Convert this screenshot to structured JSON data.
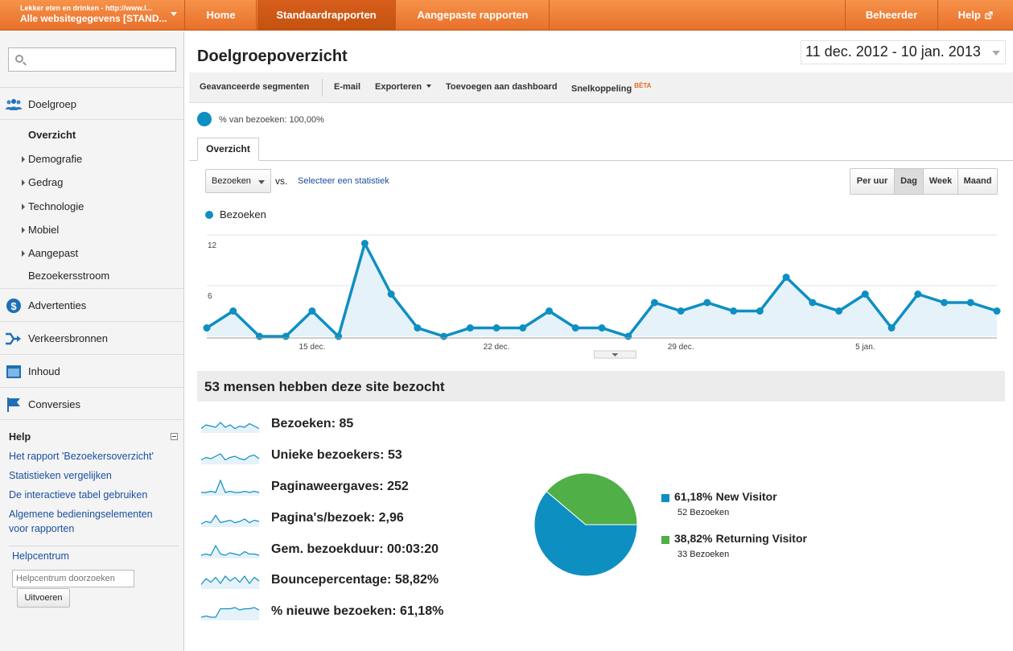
{
  "account": {
    "site": "Lekker eten en drinken - http://www.l...",
    "view": "Alle websitegegevens [STAND..."
  },
  "nav": {
    "home": "Home",
    "standard_reports": "Standaardrapporten",
    "custom_reports": "Aangepaste rapporten",
    "admin": "Beheerder",
    "help": "Help"
  },
  "sidebar": {
    "search_placeholder": "",
    "audience": "Doelgroep",
    "sub_items": [
      "Overzicht",
      "Demografie",
      "Gedrag",
      "Technologie",
      "Mobiel",
      "Aangepast",
      "Bezoekersstroom"
    ],
    "advertising": "Advertenties",
    "traffic_sources": "Verkeersbronnen",
    "content": "Inhoud",
    "conversions": "Conversies",
    "help_title": "Help",
    "help_links": [
      "Het rapport 'Bezoekersoverzicht'",
      "Statistieken vergelijken",
      "De interactieve tabel gebruiken",
      "Algemene bedieningselementen voor rapporten"
    ],
    "helpcenter": "Helpcentrum",
    "helpcenter_placeholder": "Helpcentrum doorzoeken",
    "execute": "Uitvoeren"
  },
  "page": {
    "title": "Doelgroepoverzicht",
    "date_range": "11 dec. 2012 - 10 jan. 2013"
  },
  "toolbar": {
    "advanced_segments": "Geavanceerde segmenten",
    "email": "E-mail",
    "export": "Exporteren",
    "add_to_dashboard": "Toevoegen aan dashboard",
    "shortcut": "Snelkoppeling",
    "beta": "BÈTA"
  },
  "segment": {
    "text": "% van bezoeken: 100,00%"
  },
  "tab": {
    "overview": "Overzicht"
  },
  "controls": {
    "metric": "Bezoeken",
    "vs": "vs.",
    "select_stat": "Selecteer een statistiek",
    "granularity": [
      "Per uur",
      "Dag",
      "Week",
      "Maand"
    ],
    "selected_granularity": "Dag"
  },
  "colors": {
    "accent_orange": "#e8702a",
    "series_blue": "#0e8fc2",
    "returning_green": "#50af47"
  },
  "chart_data": [
    {
      "type": "line",
      "series": [
        {
          "name": "Bezoeken",
          "values": [
            1,
            3,
            0,
            0,
            3,
            0,
            11,
            5,
            1,
            0,
            1,
            1,
            1,
            3,
            1,
            1,
            0,
            4,
            3,
            4,
            3,
            3,
            7,
            4,
            3,
            5,
            1,
            5,
            4,
            4,
            3
          ]
        }
      ],
      "x": [
        "11 dec.",
        "12 dec.",
        "13 dec.",
        "14 dec.",
        "15 dec.",
        "16 dec.",
        "17 dec.",
        "18 dec.",
        "19 dec.",
        "20 dec.",
        "21 dec.",
        "22 dec.",
        "23 dec.",
        "24 dec.",
        "25 dec.",
        "26 dec.",
        "27 dec.",
        "28 dec.",
        "29 dec.",
        "30 dec.",
        "31 dec.",
        "1 jan.",
        "2 jan.",
        "3 jan.",
        "4 jan.",
        "5 jan.",
        "6 jan.",
        "7 jan.",
        "8 jan.",
        "9 jan.",
        "10 jan."
      ],
      "x_tick_labels": [
        "15 dec.",
        "22 dec.",
        "29 dec.",
        "5 jan."
      ],
      "y_ticks": [
        "6",
        "12"
      ],
      "ylim": [
        0,
        12
      ],
      "grid": true
    },
    {
      "type": "pie",
      "slices": [
        {
          "label": "New Visitor",
          "value": 61.18,
          "percent": "61,18%",
          "count": "52 Bezoeken",
          "color": "#0e8fc2"
        },
        {
          "label": "Returning Visitor",
          "value": 38.82,
          "percent": "38,82%",
          "count": "33 Bezoeken",
          "color": "#50af47"
        }
      ]
    }
  ],
  "summary": {
    "headline": "53 mensen hebben deze site bezocht",
    "metrics": [
      {
        "label": "Bezoeken:",
        "value": "85"
      },
      {
        "label": "Unieke bezoekers:",
        "value": "53"
      },
      {
        "label": "Paginaweergaves:",
        "value": "252"
      },
      {
        "label": "Pagina's/bezoek:",
        "value": "2,96"
      },
      {
        "label": "Gem. bezoekduur:",
        "value": "00:03:20"
      },
      {
        "label": "Bouncepercentage:",
        "value": "58,82%"
      },
      {
        "label": "% nieuwe bezoeken:",
        "value": "61,18%"
      }
    ]
  }
}
